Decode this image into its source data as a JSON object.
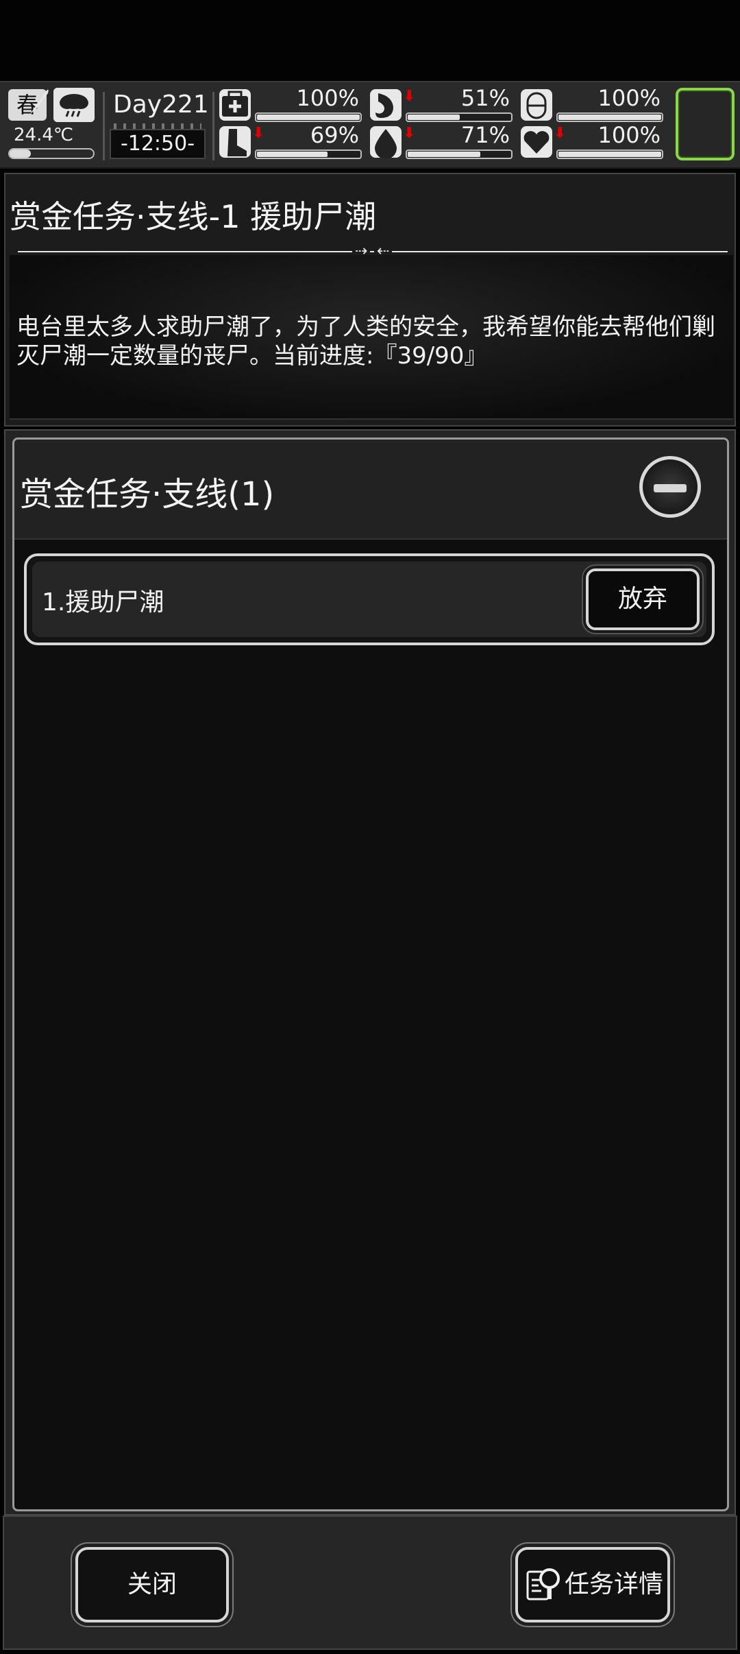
{
  "status": {
    "season": "春",
    "temperature": "24.4℃",
    "temperature_level": 0.25,
    "day": "Day221",
    "time": "-12:50-",
    "stats": [
      {
        "icon": "medkit-icon",
        "value": "100%",
        "level": 1.0,
        "down": false
      },
      {
        "icon": "stomach-icon",
        "value": "51%",
        "level": 0.51,
        "down": true
      },
      {
        "icon": "pill-icon",
        "value": "100%",
        "level": 1.0,
        "down": false
      },
      {
        "icon": "leg-icon",
        "value": "69%",
        "level": 0.69,
        "down": true
      },
      {
        "icon": "water-drop-icon",
        "value": "71%",
        "level": 0.71,
        "down": true
      },
      {
        "icon": "heart-icon",
        "value": "100%",
        "level": 1.0,
        "down": true
      }
    ],
    "down_arrow": "⬇",
    "slot_color": "#8bd64a"
  },
  "quest_detail": {
    "title": "赏金任务·支线-1 援助尸潮",
    "description": "电台里太多人求助尸潮了，为了人类的安全，我希望你能去帮他们剿灭尸潮一定数量的丧尸。当前进度:『39/90』",
    "divider_left": "⇢",
    "divider_right": "⇠"
  },
  "quest_list": {
    "category_title": "赏金任务·支线(1)",
    "items": [
      {
        "label": "1.援助尸潮",
        "action": "放弃"
      }
    ]
  },
  "footer": {
    "close_label": "关闭",
    "detail_label": "任务详情"
  }
}
